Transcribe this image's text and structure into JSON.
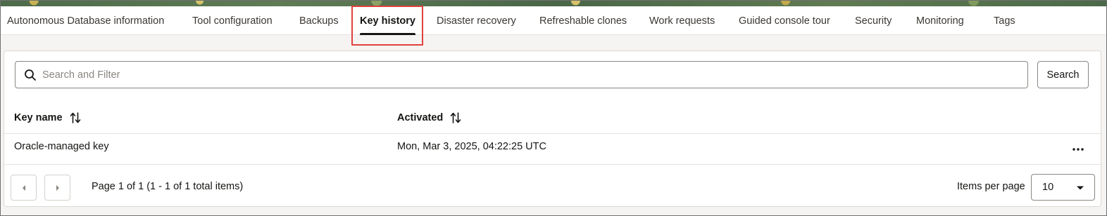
{
  "tabs": [
    {
      "label": "Autonomous Database information",
      "active": false
    },
    {
      "label": "Tool configuration",
      "active": false
    },
    {
      "label": "Backups",
      "active": false
    },
    {
      "label": "Key history",
      "active": true
    },
    {
      "label": "Disaster recovery",
      "active": false
    },
    {
      "label": "Refreshable clones",
      "active": false
    },
    {
      "label": "Work requests",
      "active": false
    },
    {
      "label": "Guided console tour",
      "active": false
    },
    {
      "label": "Security",
      "active": false
    },
    {
      "label": "Monitoring",
      "active": false
    },
    {
      "label": "Tags",
      "active": false
    }
  ],
  "search": {
    "placeholder": "Search and Filter",
    "value": "",
    "button_label": "Search",
    "icon": "search-icon"
  },
  "table": {
    "columns": [
      {
        "label": "Key name",
        "sortable": true,
        "icon": "sort-icon"
      },
      {
        "label": "Activated",
        "sortable": true,
        "icon": "sort-icon"
      }
    ],
    "rows": [
      {
        "key_name": "Oracle-managed key",
        "activated": "Mon, Mar 3, 2025, 04:22:25 UTC",
        "actions_icon": "more-actions-icon"
      }
    ]
  },
  "pagination": {
    "prev_icon": "chevron-left-icon",
    "next_icon": "chevron-right-icon",
    "page_info": "Page 1 of 1 (1 - 1 of 1 total items)",
    "items_per_page_label": "Items per page",
    "items_per_page_value": "10"
  },
  "colors": {
    "highlight": "#e0413c",
    "active_tab_underline": "#161513",
    "banner": "#4d6b4a"
  }
}
